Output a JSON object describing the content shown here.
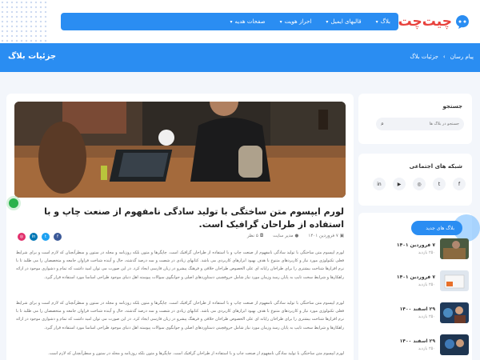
{
  "header": {
    "logo_text": "چیت‌چت",
    "nav": [
      {
        "label": "بلاگ"
      },
      {
        "label": "قالبهای ایمیل"
      },
      {
        "label": "احراز هویت"
      },
      {
        "label": "صفحات هدیه"
      }
    ]
  },
  "banner": {
    "title": "جزئیات بلاگ",
    "breadcrumb": [
      "پیام رسان",
      "جزئیات بلاگ"
    ],
    "separator": "›"
  },
  "post": {
    "title": "لورم ایپسوم متن ساختگی با تولید سادگی نامفهوم از صنعت چاپ و با استفاده از طراحان گرافیک است.",
    "date": "۷ فروردین ۱۴۰۱",
    "author": "مدیر سایت",
    "comments": "۵ نظر",
    "paragraphs": [
      "لورم ایپسوم متن ساختگی با تولید سادگی نامفهوم از صنعت چاپ و با استفاده از طراحان گرافیک است. چاپگرها و متون بلکه روزنامه و مجله در ستون و سطرآنچنان که لازم است و برای شرایط فعلی تکنولوژی مورد نیاز و کاربردهای متنوع با هدف بهبود ابزارهای کاربردی می باشد. کتابهای زیادی در شصت و سه درصد گذشته، حال و آینده شناخت فراوان جامعه و متخصصان را می طلبد تا با نرم افزارها شناخت بیشتری را برای طراحان رایانه ای علی الخصوص طراحان خلاقی و فرهنگ پیشرو در زبان فارسی ایجاد کرد. در این صورت می توان امید داشت که تمام و دشواری موجود در ارائه راهکارها و شرایط سخت تایپ به پایان رسد وزمان مورد نیاز شامل حروفچینی دستاوردهای اصلی و جوابگوی سوالات پیوسته اهل دنیای موجود طراحی اساسا مورد استفاده قرار گیرد.",
      "لورم ایپسوم متن ساختگی با تولید سادگی نامفهوم از صنعت چاپ و با استفاده از طراحان گرافیک است. چاپگرها و متون بلکه روزنامه و مجله در ستون و سطرآنچنان که لازم است و برای شرایط فعلی تکنولوژی مورد نیاز و کاربردهای متنوع با هدف بهبود ابزارهای کاربردی می باشد. کتابهای زیادی در شصت و سه درصد گذشته، حال و آینده شناخت فراوان جامعه و متخصصان را می طلبد تا با نرم افزارها شناخت بیشتری را برای طراحان رایانه ای علی الخصوص طراحان خلاقی و فرهنگ پیشرو در زبان فارسی ایجاد کرد. در این صورت می توان امید داشت که تمام و دشواری موجود در ارائه راهکارها و شرایط سخت تایپ به پایان رسد وزمان مورد نیاز شامل حروفچینی دستاوردهای اصلی و جوابگوی سوالات پیوسته اهل دنیای موجود طراحی اساسا مورد استفاده قرار گیرد.",
      "لورم ایپسوم متن ساختگی با تولید سادگی نامفهوم از صنعت چاپ و با استفاده از طراحان گرافیک است. چاپگرها و متون بلکه روزنامه و مجله در ستون و سطرآنچنان که لازم است."
    ],
    "share": [
      {
        "icon": "facebook-icon",
        "glyph": "f",
        "color": "#3b5998"
      },
      {
        "icon": "twitter-icon",
        "glyph": "t",
        "color": "#1da1f2"
      },
      {
        "icon": "linkedin-icon",
        "glyph": "in",
        "color": "#0077b5"
      },
      {
        "icon": "instagram-icon",
        "glyph": "◎",
        "color": "#e1306c"
      }
    ]
  },
  "sidebar": {
    "search": {
      "title": "جستجو",
      "placeholder": "جستجو در بلاگ ها"
    },
    "social": {
      "title": "شبکه های اجتماعی",
      "icons": [
        {
          "name": "facebook-icon",
          "glyph": "f"
        },
        {
          "name": "twitter-icon",
          "glyph": "t"
        },
        {
          "name": "instagram-icon",
          "glyph": "◎"
        },
        {
          "name": "youtube-icon",
          "glyph": "▶"
        },
        {
          "name": "linkedin-icon",
          "glyph": "in"
        }
      ]
    },
    "new_blogs": {
      "title": "بلاگ های جدید",
      "items": [
        {
          "date": "۷ فروردین ۱۴۰۱",
          "visits": "۲۵۰ بازدید"
        },
        {
          "date": "۷ فروردین ۱۴۰۱",
          "visits": "۲۵۰ بازدید"
        },
        {
          "date": "۲۹ اسفند ۱۴۰۰",
          "visits": "۲۵۰ بازدید"
        },
        {
          "date": "۲۹ اسفند ۱۴۰۰",
          "visits": "۲۵۰ بازدید"
        }
      ]
    }
  },
  "colors": {
    "primary": "#2a8df2",
    "logo": "#e8413c",
    "accent_green": "#2bb24c"
  }
}
